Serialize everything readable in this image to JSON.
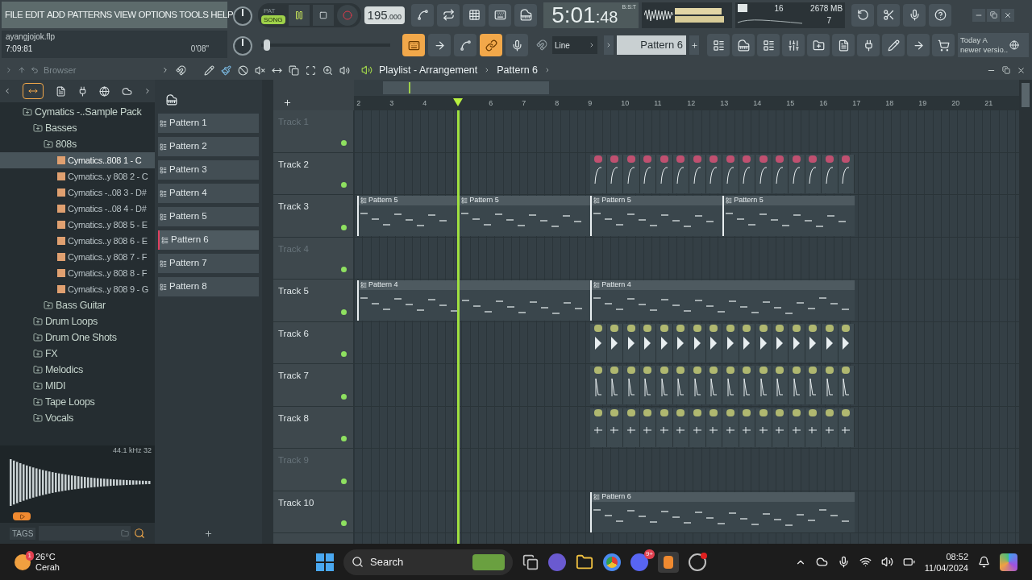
{
  "menu": [
    "FILE",
    "EDIT",
    "ADD",
    "PATTERNS",
    "VIEW",
    "OPTIONS",
    "TOOLS",
    "HELP"
  ],
  "project": {
    "file": "ayangjojok.flp",
    "length": "7:09:81",
    "time": "0'08\""
  },
  "transport": {
    "modes": [
      {
        "label": "PAT",
        "selected": false
      },
      {
        "label": "SONG",
        "selected": true
      }
    ],
    "playing": true,
    "tempo": "195",
    "tempo_decimal": ".000"
  },
  "toggles": [
    {
      "on": true
    },
    {
      "on": false
    },
    {
      "on": false
    },
    {
      "on": true
    },
    {
      "on": false
    }
  ],
  "master_pitch": {
    "level": 0.03
  },
  "clock": {
    "main": "5:01",
    "small": ":48",
    "unit": "B:S:T"
  },
  "monitor": {
    "polyphony": "16",
    "memory": "2678 MB",
    "cpu": "7"
  },
  "snap": "Line",
  "pattern_selector": "Pattern 6",
  "news": {
    "line1": "Today  A",
    "line2": "newer versio.."
  },
  "browser": {
    "title": "Browser",
    "tree": [
      {
        "label": "Cymatics -..Sample Pack",
        "kind": "folder",
        "selected": false,
        "children": [
          {
            "label": "Basses",
            "kind": "folder",
            "selected": false,
            "children": [
              {
                "label": "808s",
                "kind": "folder",
                "selected": false,
                "children": [
                  {
                    "label": "Cymatics..808 1 - C",
                    "kind": "file",
                    "selected": true
                  },
                  {
                    "label": "Cymatics..y 808 2 - C",
                    "kind": "file",
                    "selected": false
                  },
                  {
                    "label": "Cymatics -..08 3 - D#",
                    "kind": "file",
                    "selected": false
                  },
                  {
                    "label": "Cymatics -..08 4 - D#",
                    "kind": "file",
                    "selected": false
                  },
                  {
                    "label": "Cymatics..y 808 5 - E",
                    "kind": "file",
                    "selected": false
                  },
                  {
                    "label": "Cymatics..y 808 6 - E",
                    "kind": "file",
                    "selected": false
                  },
                  {
                    "label": "Cymatics..y 808 7 - F",
                    "kind": "file",
                    "selected": false
                  },
                  {
                    "label": "Cymatics..y 808 8 - F",
                    "kind": "file",
                    "selected": false
                  },
                  {
                    "label": "Cymatics..y 808 9 - G",
                    "kind": "file",
                    "selected": false
                  }
                ]
              },
              {
                "label": "Bass Guitar",
                "kind": "folder",
                "selected": false
              }
            ]
          },
          {
            "label": "Drum Loops",
            "kind": "folder",
            "selected": false
          },
          {
            "label": "Drum One Shots",
            "kind": "folder",
            "selected": false
          },
          {
            "label": "FX",
            "kind": "folder",
            "selected": false
          },
          {
            "label": "Melodics",
            "kind": "folder",
            "selected": false
          },
          {
            "label": "MIDI",
            "kind": "folder",
            "selected": false
          },
          {
            "label": "Tape Loops",
            "kind": "folder",
            "selected": false
          },
          {
            "label": "Vocals",
            "kind": "folder",
            "selected": false
          }
        ]
      }
    ],
    "sample_info": "44.1 kHz 32",
    "tags": "TAGS"
  },
  "patterns": [
    {
      "label": "Pattern 1",
      "selected": false
    },
    {
      "label": "Pattern 2",
      "selected": false
    },
    {
      "label": "Pattern 3",
      "selected": false
    },
    {
      "label": "Pattern 4",
      "selected": false
    },
    {
      "label": "Pattern 5",
      "selected": false
    },
    {
      "label": "Pattern 6",
      "selected": true
    },
    {
      "label": "Pattern 7",
      "selected": false
    },
    {
      "label": "Pattern 8",
      "selected": false
    }
  ],
  "playlist": {
    "title": "Playlist - Arrangement",
    "pattern": "Pattern 6",
    "ruler": [
      "2",
      "3",
      "4",
      "6",
      "7",
      "8",
      "9",
      "10",
      "11",
      "12",
      "13",
      "14",
      "15",
      "16",
      "17",
      "18",
      "19",
      "20",
      "21"
    ],
    "tracks": [
      {
        "name": "Track 1",
        "empty": true
      },
      {
        "name": "Track 2",
        "empty": false,
        "clips": [
          {
            "kind": "slide"
          }
        ]
      },
      {
        "name": "Track 3",
        "empty": false,
        "clips": [
          {
            "kind": "notes",
            "label": "Pattern 5"
          },
          {
            "kind": "notes",
            "label": "Pattern 5"
          },
          {
            "kind": "notes",
            "label": "Pattern 5"
          },
          {
            "kind": "notes",
            "label": "Pattern 5"
          }
        ]
      },
      {
        "name": "Track 4",
        "empty": true
      },
      {
        "name": "Track 5",
        "empty": false,
        "clips": [
          {
            "kind": "notes",
            "label": "Pattern 4"
          },
          {
            "kind": "notes",
            "label": "Pattern 4"
          }
        ]
      },
      {
        "name": "Track 6",
        "empty": false,
        "clips": [
          {
            "kind": "triangle"
          }
        ]
      },
      {
        "name": "Track 7",
        "empty": false,
        "clips": [
          {
            "kind": "spike"
          }
        ]
      },
      {
        "name": "Track 8",
        "empty": false,
        "clips": [
          {
            "kind": "tick"
          }
        ]
      },
      {
        "name": "Track 9",
        "empty": true
      },
      {
        "name": "Track 10",
        "empty": false,
        "clips": [
          {
            "kind": "notes",
            "label": "Pattern 6"
          }
        ]
      }
    ]
  },
  "taskbar": {
    "weather": {
      "temp": "26°C",
      "text": "Cerah",
      "badge": "1"
    },
    "search": "Search",
    "chat_badge": "9+",
    "time": "08:52",
    "date": "11/04/2024"
  }
}
